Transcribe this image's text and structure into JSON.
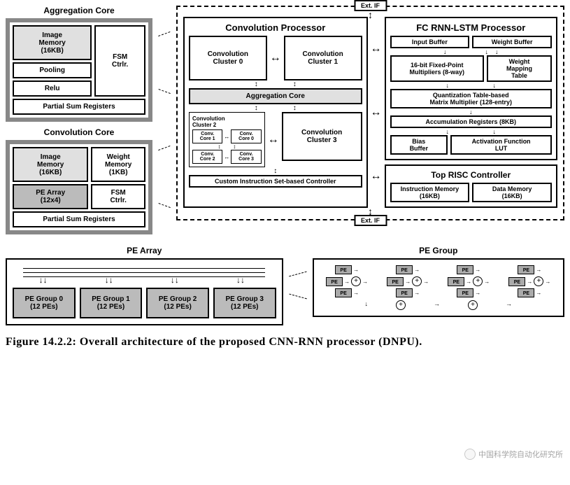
{
  "ext_if": "Ext. IF",
  "left": {
    "agg": {
      "title": "Aggregation Core",
      "imgmem": "Image\nMemory\n(16KB)",
      "fsm": "FSM\nCtrlr.",
      "pool": "Pooling",
      "relu": "Relu",
      "psr": "Partial Sum Registers"
    },
    "conv": {
      "title": "Convolution Core",
      "imgmem": "Image\nMemory\n(16KB)",
      "wmem": "Weight\nMemory\n(1KB)",
      "pe": "PE Array\n(12x4)",
      "fsm": "FSM\nCtrlr.",
      "psr": "Partial Sum Registers"
    }
  },
  "main": {
    "conv_proc": {
      "title": "Convolution Processor",
      "c0": "Convolution\nCluster 0",
      "c1": "Convolution\nCluster 1",
      "agg": "Aggregation Core",
      "c2_title": "Convolution\nCluster 2",
      "core0": "Conv.\nCore 0",
      "core1": "Conv.\nCore 1",
      "core2": "Conv.\nCore 2",
      "core3": "Conv.\nCore 3",
      "c3": "Convolution\nCluster 3",
      "ctrl": "Custom Instruction Set-based Controller"
    },
    "fc": {
      "title": "FC RNN-LSTM Processor",
      "inbuf": "Input Buffer",
      "wbuf": "Weight Buffer",
      "fpm": "16-bit Fixed-Point\nMultipliers (8-way)",
      "wmap": "Weight\nMapping\nTable",
      "qtab": "Quantization Table-based\nMatrix Multiplier (128-entry)",
      "acc": "Accumulation Registers (8KB)",
      "bias": "Bias\nBuffer",
      "act": "Activation Function\nLUT"
    },
    "risc": {
      "title": "Top RISC Controller",
      "imem": "Instruction Memory\n(16KB)",
      "dmem": "Data Memory\n(16KB)"
    }
  },
  "pearr": {
    "title": "PE Array",
    "g0": "PE Group 0\n(12 PEs)",
    "g1": "PE Group 1\n(12 PEs)",
    "g2": "PE Group 2\n(12 PEs)",
    "g3": "PE Group 3\n(12 PEs)"
  },
  "pegrp": {
    "title": "PE Group",
    "pe": "PE"
  },
  "caption": "Figure 14.2.2: Overall architecture of the proposed CNN-RNN processor (DNPU).",
  "watermark": "中国科学院自动化研究所"
}
